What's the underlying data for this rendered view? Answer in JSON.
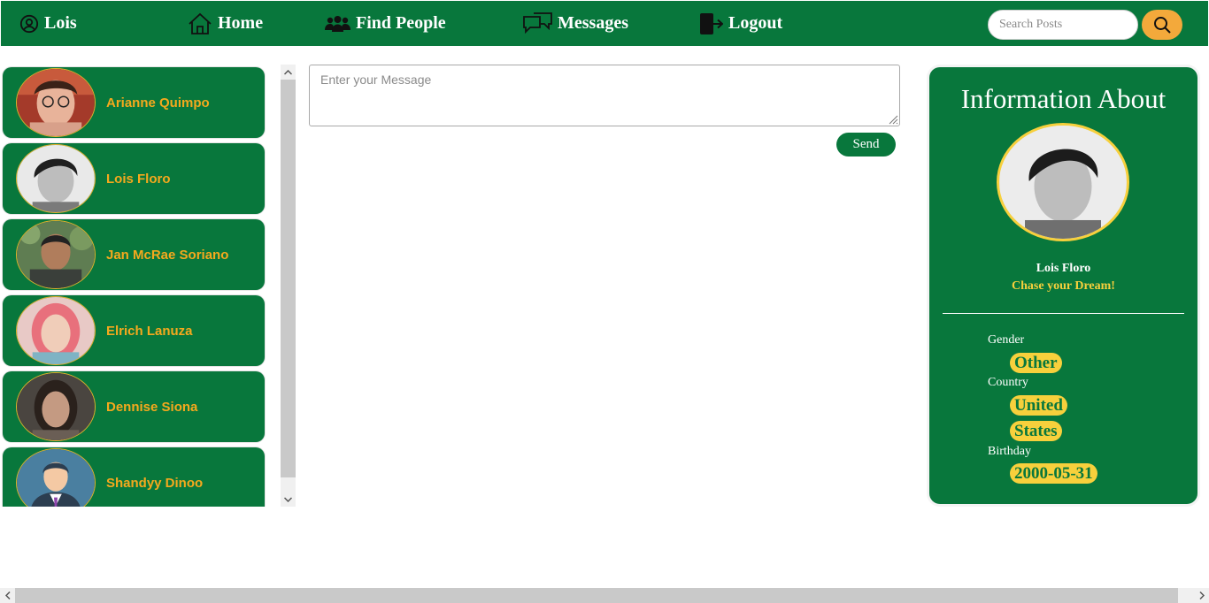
{
  "nav": {
    "user_label": "Lois",
    "items": [
      {
        "label": "Home",
        "icon": "home-icon"
      },
      {
        "label": "Find People",
        "icon": "users-icon"
      },
      {
        "label": "Messages",
        "icon": "chat-icon"
      },
      {
        "label": "Logout",
        "icon": "logout-icon"
      }
    ],
    "search_placeholder": "Search Posts",
    "search_icon": "search-icon"
  },
  "friends": [
    {
      "name": "Arianne Quimpo"
    },
    {
      "name": "Lois Floro"
    },
    {
      "name": "Jan McRae Soriano"
    },
    {
      "name": "Elrich Lanuza"
    },
    {
      "name": "Dennise Siona"
    },
    {
      "name": "Shandyy Dinoo"
    }
  ],
  "message": {
    "placeholder": "Enter your Message",
    "value": "",
    "send_label": "Send"
  },
  "info": {
    "title": "Information About",
    "name": "Lois Floro",
    "motto": "Chase your Dream!",
    "gender_label": "Gender",
    "gender": "Other",
    "country_label": "Country",
    "country": "United States",
    "birthday_label": "Birthday",
    "birthday": "2000-05-31"
  },
  "colors": {
    "brand_green": "#08773c",
    "accent_orange": "#f3a93b",
    "name_orange": "#f5a91d",
    "highlight_yellow": "#f7d03c"
  }
}
